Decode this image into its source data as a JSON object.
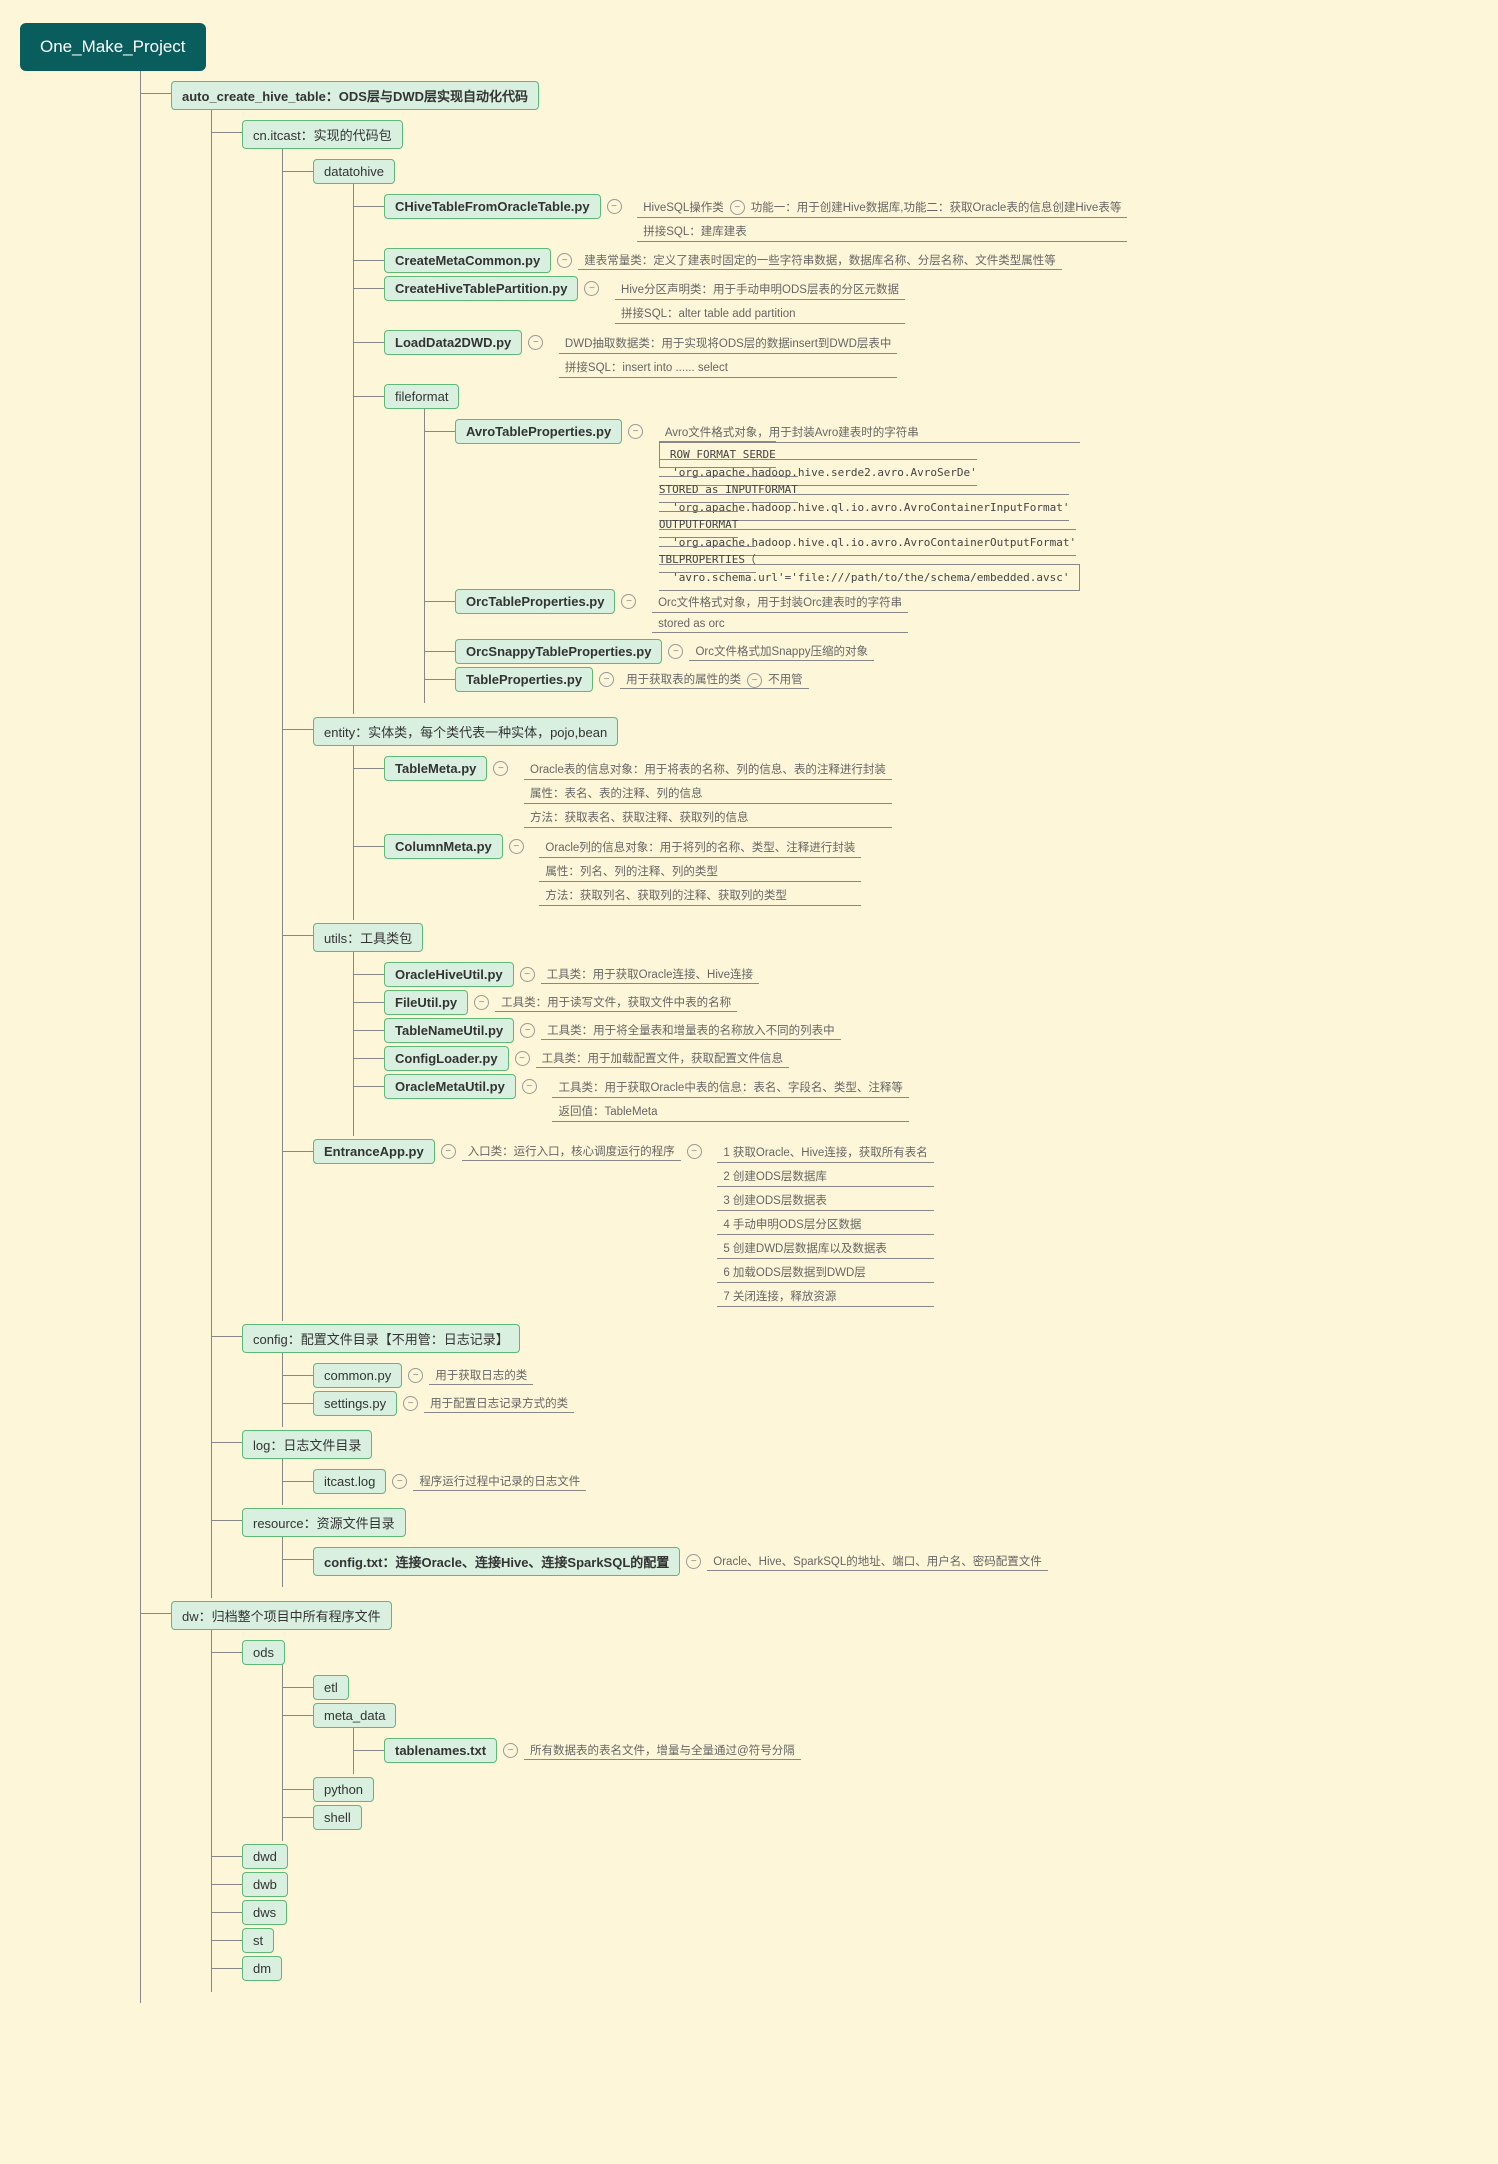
{
  "root": "One_Make_Project",
  "auto": {
    "label": "auto_create_hive_table：ODS层与DWD层实现自动化代码"
  },
  "cn": {
    "label": "cn.itcast：实现的代码包"
  },
  "datatohive": {
    "label": "datatohive"
  },
  "chive": {
    "label": "CHiveTableFromOracleTable.py",
    "a": "HiveSQL操作类",
    "b": "功能一：用于创建Hive数据库,功能二：获取Oracle表的信息创建Hive表等",
    "c": "拼接SQL：建库建表"
  },
  "cmeta": {
    "label": "CreateMetaCommon.py",
    "a": "建表常量类：定义了建表时固定的一些字符串数据，数据库名称、分层名称、文件类型属性等"
  },
  "cpart": {
    "label": "CreateHiveTablePartition.py",
    "a": "Hive分区声明类：用于手动申明ODS层表的分区元数据",
    "b": "拼接SQL：alter table add partition"
  },
  "ldwd": {
    "label": "LoadData2DWD.py",
    "a": "DWD抽取数据类：用于实现将ODS层的数据insert到DWD层表中",
    "b": "拼接SQL：insert into ...... select"
  },
  "ff": {
    "label": "fileformat"
  },
  "avro": {
    "label": "AvroTableProperties.py",
    "a": "Avro文件格式对象，用于封装Avro建表时的字符串",
    "code": "ROW FORMAT SERDE\n  'org.apache.hadoop.hive.serde2.avro.AvroSerDe'\nSTORED as INPUTFORMAT\n  'org.apache.hadoop.hive.ql.io.avro.AvroContainerInputFormat'\nOUTPUTFORMAT\n  'org.apache.hadoop.hive.ql.io.avro.AvroContainerOutputFormat'\nTBLPROPERTIES（\n  'avro.schema.url'='file:///path/to/the/schema/embedded.avsc'"
  },
  "orc": {
    "label": "OrcTableProperties.py",
    "a": "Orc文件格式对象，用于封装Orc建表时的字符串",
    "b": "stored as orc"
  },
  "orcs": {
    "label": "OrcSnappyTableProperties.py",
    "a": "Orc文件格式加Snappy压缩的对象"
  },
  "tprop": {
    "label": "TableProperties.py",
    "a": "用于获取表的属性的类",
    "b": "不用管"
  },
  "entity": {
    "label": "entity：实体类，每个类代表一种实体，pojo,bean"
  },
  "tmeta": {
    "label": "TableMeta.py",
    "a": "Oracle表的信息对象：用于将表的名称、列的信息、表的注释进行封装",
    "b": "属性：表名、表的注释、列的信息",
    "c": "方法：获取表名、获取注释、获取列的信息"
  },
  "cmeta2": {
    "label": "ColumnMeta.py",
    "a": "Oracle列的信息对象：用于将列的名称、类型、注释进行封装",
    "b": "属性：列名、列的注释、列的类型",
    "c": "方法：获取列名、获取列的注释、获取列的类型"
  },
  "utils": {
    "label": "utils：工具类包"
  },
  "ohu": {
    "label": "OracleHiveUtil.py",
    "a": "工具类：用于获取Oracle连接、Hive连接"
  },
  "fu": {
    "label": "FileUtil.py",
    "a": "工具类：用于读写文件，获取文件中表的名称"
  },
  "tnu": {
    "label": "TableNameUtil.py",
    "a": "工具类：用于将全量表和增量表的名称放入不同的列表中"
  },
  "cl": {
    "label": "ConfigLoader.py",
    "a": "工具类：用于加载配置文件，获取配置文件信息"
  },
  "omu": {
    "label": "OracleMetaUtil.py",
    "a": "工具类：用于获取Oracle中表的信息：表名、字段名、类型、注释等",
    "b": "返回值：TableMeta"
  },
  "ent": {
    "label": "EntranceApp.py",
    "a": "入口类：运行入口，核心调度运行的程序",
    "s1": "1  获取Oracle、Hive连接，获取所有表名",
    "s2": "2  创建ODS层数据库",
    "s3": "3  创建ODS层数据表",
    "s4": "4  手动申明ODS层分区数据",
    "s5": "5  创建DWD层数据库以及数据表",
    "s6": "6  加载ODS层数据到DWD层",
    "s7": "7  关闭连接，释放资源"
  },
  "config": {
    "label": "config：配置文件目录【不用管：日志记录】"
  },
  "common": {
    "label": "common.py",
    "a": "用于获取日志的类"
  },
  "settings": {
    "label": "settings.py",
    "a": "用于配置日志记录方式的类"
  },
  "log": {
    "label": "log：日志文件目录"
  },
  "itcast": {
    "label": "itcast.log",
    "a": "程序运行过程中记录的日志文件"
  },
  "res": {
    "label": "resource：资源文件目录"
  },
  "cfgtxt": {
    "label": "config.txt：连接Oracle、连接Hive、连接SparkSQL的配置",
    "a": "Oracle、Hive、SparkSQL的地址、端口、用户名、密码配置文件"
  },
  "dw": {
    "label": "dw：归档整个项目中所有程序文件"
  },
  "ods": {
    "label": "ods"
  },
  "etl": {
    "label": "etl"
  },
  "md": {
    "label": "meta_data"
  },
  "tn": {
    "label": "tablenames.txt",
    "a": "所有数据表的表名文件，增量与全量通过@符号分隔"
  },
  "python": {
    "label": "python"
  },
  "shell": {
    "label": "shell"
  },
  "dwd": {
    "label": "dwd"
  },
  "dwb": {
    "label": "dwb"
  },
  "dws": {
    "label": "dws"
  },
  "st": {
    "label": "st"
  },
  "dm": {
    "label": "dm"
  }
}
